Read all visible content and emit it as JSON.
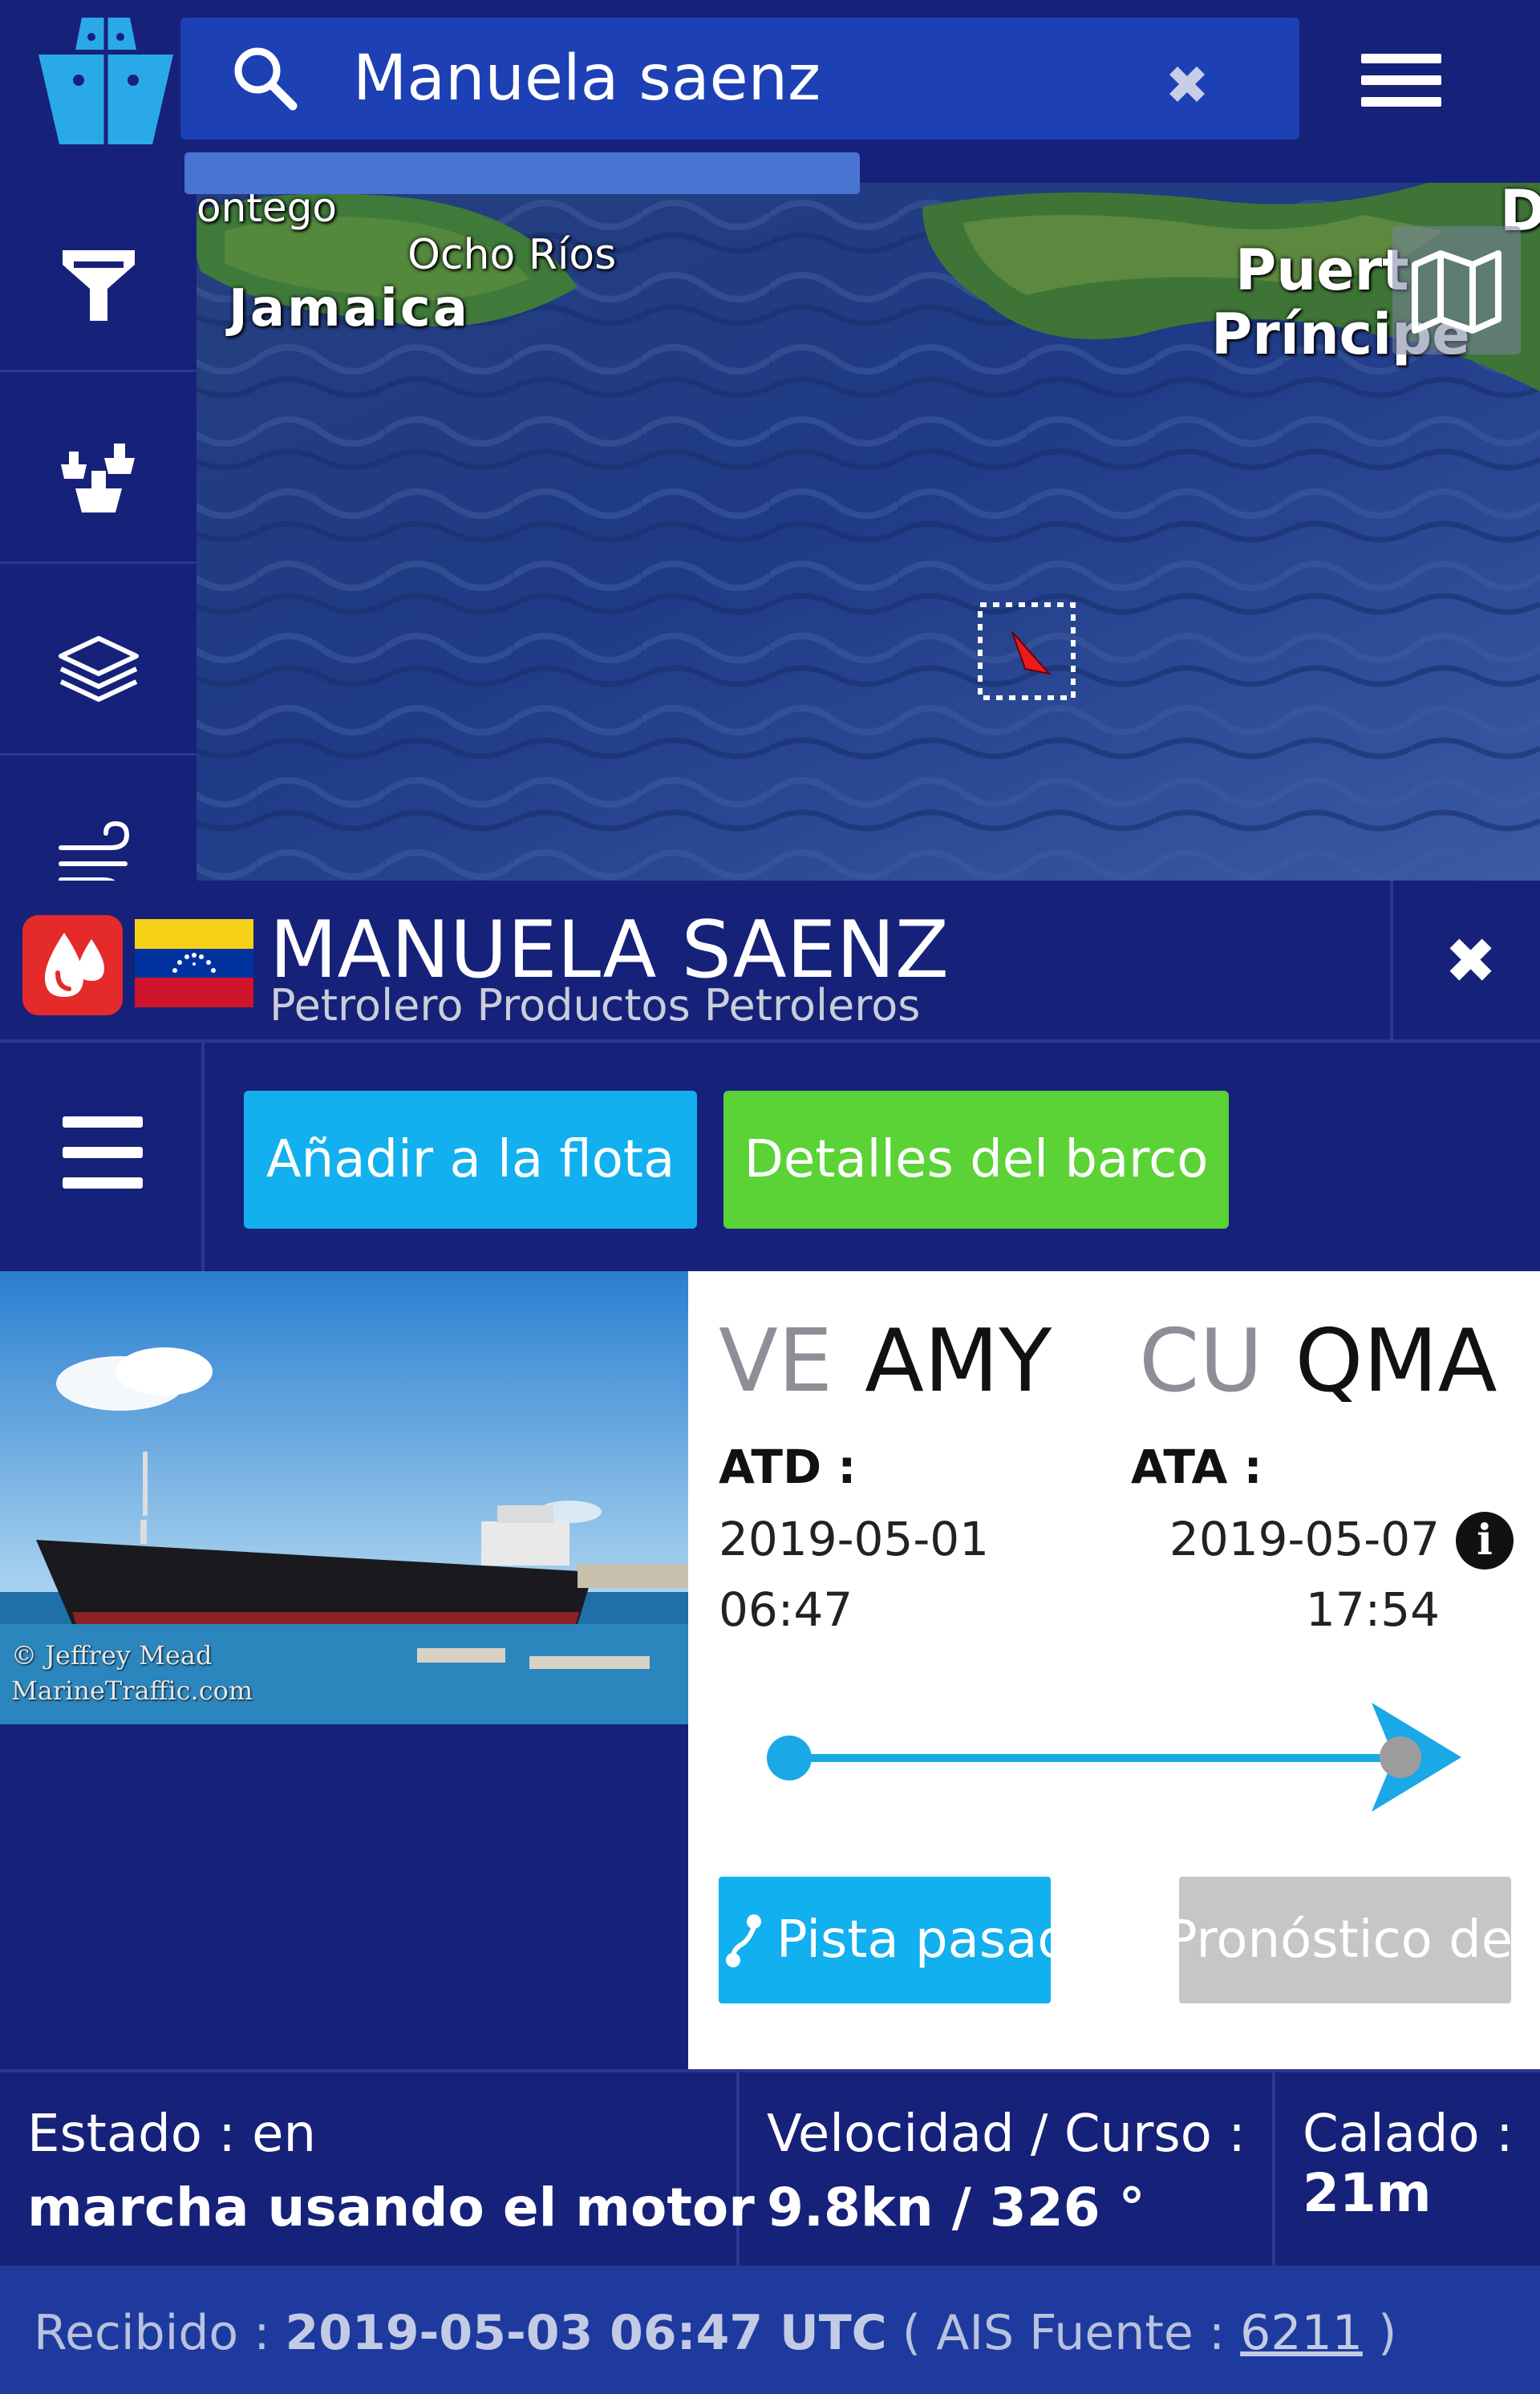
{
  "search": {
    "query": "Manuela saenz",
    "clear_glyph": "✖"
  },
  "map": {
    "labels": {
      "montego": "ontego",
      "ocho_rios": "Ocho Ríos",
      "jamaica": "Jamaica",
      "puerto": "Puert",
      "principe": "Príncipe",
      "d": "D"
    }
  },
  "vessel": {
    "name": "MANUELA SAENZ",
    "type": "Petrolero Productos Petroleros",
    "close_glyph": "✖"
  },
  "actions": {
    "add_fleet": "Añadir a la flota",
    "details": "Detalles del barco"
  },
  "photo": {
    "credit_line1": "© Jeffrey Mead",
    "credit_line2": "MarineTraffic.com"
  },
  "voyage": {
    "departure": {
      "country": "VE",
      "port": "AMY",
      "label": "ATD :",
      "date": "2019-05-01",
      "time": "06:47"
    },
    "arrival": {
      "country": "CU",
      "port": "QMA",
      "label": "ATA :",
      "date": "2019-05-07",
      "time": "17:54"
    },
    "info_glyph": "i",
    "progress": 1.0,
    "past_track": "Pista pasad",
    "forecast": "Pronóstico de"
  },
  "stats": {
    "status_label": "Estado : en",
    "status_value": "marcha usando el motor",
    "speed_label": "Velocidad / Curso :",
    "speed_value": "9.8kn / 326 °",
    "draught_label": "Calado :",
    "draught_value": "21m"
  },
  "received": {
    "label": "Recibido : ",
    "timestamp": "2019-05-03 06:47 UTC",
    "ais_prefix": " ( AIS Fuente : ",
    "ais_source": "6211",
    "ais_suffix": " )"
  },
  "colors": {
    "header_bg": "#16217a",
    "accent_blue": "#12b0ee",
    "accent_green": "#5bd236",
    "vessel_icon_red": "#e52a2a"
  },
  "icons": {
    "logo": "marinetraffic-ship-logo",
    "search": "search-icon",
    "menu": "hamburger-icon",
    "filter": "filter-icon",
    "fleet": "fleet-icon",
    "layers": "layers-icon",
    "wind": "wind-icon",
    "map_type": "map-icon",
    "vessel_type": "oil-drop-icon",
    "flag": "venezuela-flag"
  }
}
